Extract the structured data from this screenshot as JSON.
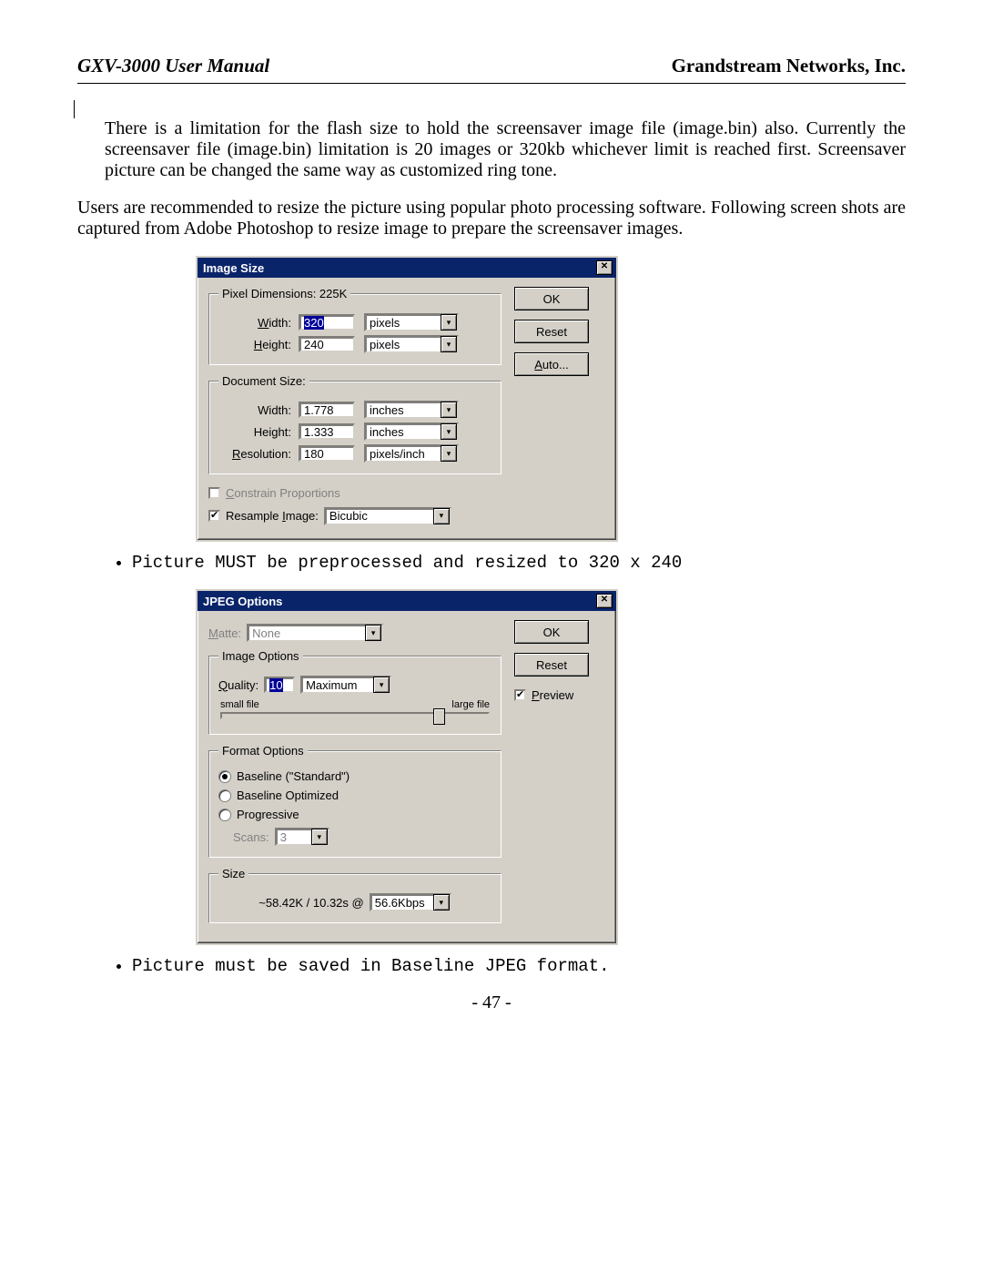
{
  "header": {
    "left": "GXV-3000 User Manual",
    "right": "Grandstream Networks, Inc."
  },
  "paragraphs": {
    "p1": "There is a limitation for the flash size to hold the screensaver image file (image.bin) also. Currently the screensaver file (image.bin) limitation is 20 images or 320kb whichever limit is reached first. Screensaver picture can be changed the same way as customized ring tone.",
    "p2": "Users are recommended to resize the picture using popular photo processing software. Following screen shots are captured from Adobe Photoshop to resize image to prepare the screensaver images."
  },
  "bullets": {
    "b1": "Picture MUST be preprocessed and resized to 320 x 240",
    "b2": "Picture must be saved in Baseline JPEG format."
  },
  "dialog1": {
    "title": "Image Size",
    "pixel_dimensions_label": "Pixel Dimensions:  225K",
    "width_label": "Width:",
    "width_value": "320",
    "height_label": "Height:",
    "height_value": "240",
    "unit_pixels": "pixels",
    "doc_size_label": "Document Size:",
    "doc_width_label": "Width:",
    "doc_width_value": "1.778",
    "doc_height_label": "Height:",
    "doc_height_value": "1.333",
    "resolution_label": "Resolution:",
    "resolution_value": "180",
    "unit_inches": "inches",
    "unit_ppi": "pixels/inch",
    "constrain_label": "Constrain Proportions",
    "resample_label": "Resample Image:",
    "resample_value": "Bicubic",
    "ok": "OK",
    "reset": "Reset",
    "auto": "Auto..."
  },
  "dialog2": {
    "title": "JPEG Options",
    "matte_label": "Matte:",
    "matte_value": "None",
    "image_options_label": "Image Options",
    "quality_label": "Quality:",
    "quality_value": "10",
    "quality_preset": "Maximum",
    "small_file": "small file",
    "large_file": "large file",
    "format_options_label": "Format Options",
    "baseline_std": "Baseline (\"Standard\")",
    "baseline_opt": "Baseline Optimized",
    "progressive": "Progressive",
    "scans_label": "Scans:",
    "scans_value": "3",
    "size_label": "Size",
    "size_text": "~58.42K / 10.32s   @",
    "bitrate": "56.6Kbps",
    "ok": "OK",
    "reset": "Reset",
    "preview": "Preview"
  },
  "page_number": "- 47 -"
}
